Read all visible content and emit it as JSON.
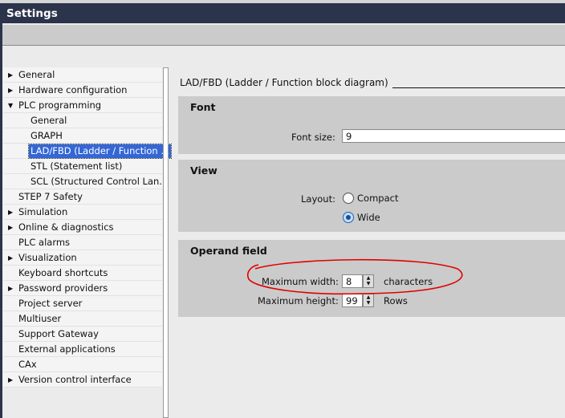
{
  "window": {
    "title": "Settings"
  },
  "tree": [
    {
      "label": "General",
      "arrow": "▶"
    },
    {
      "label": "Hardware configuration",
      "arrow": "▶"
    },
    {
      "label": "PLC programming",
      "arrow": "▼"
    },
    {
      "label": "General",
      "sub": true
    },
    {
      "label": "GRAPH",
      "sub": true
    },
    {
      "label": "LAD/FBD (Ladder / Function ...",
      "sub": true,
      "selected": true
    },
    {
      "label": "STL (Statement list)",
      "sub": true
    },
    {
      "label": "SCL (Structured Control Lan...",
      "sub": true
    },
    {
      "label": "STEP 7 Safety"
    },
    {
      "label": "Simulation",
      "arrow": "▶"
    },
    {
      "label": "Online & diagnostics",
      "arrow": "▶"
    },
    {
      "label": "PLC alarms"
    },
    {
      "label": "Visualization",
      "arrow": "▶"
    },
    {
      "label": "Keyboard shortcuts"
    },
    {
      "label": "Password providers",
      "arrow": "▶"
    },
    {
      "label": "Project server"
    },
    {
      "label": "Multiuser"
    },
    {
      "label": "Support Gateway"
    },
    {
      "label": "External applications"
    },
    {
      "label": "CAx"
    },
    {
      "label": "Version control interface",
      "arrow": "▶"
    }
  ],
  "content": {
    "heading": "LAD/FBD (Ladder / Function block diagram)",
    "font": {
      "title": "Font",
      "size_label": "Font size:",
      "size_value": "9"
    },
    "view": {
      "title": "View",
      "layout_label": "Layout:",
      "compact": "Compact",
      "wide": "Wide",
      "selected": "Wide"
    },
    "operand": {
      "title": "Operand field",
      "width_label": "Maximum width:",
      "width_value": "8",
      "width_unit": "characters",
      "height_label": "Maximum height:",
      "height_value": "99",
      "height_unit": "Rows"
    }
  },
  "annotation_color": "#e00000"
}
